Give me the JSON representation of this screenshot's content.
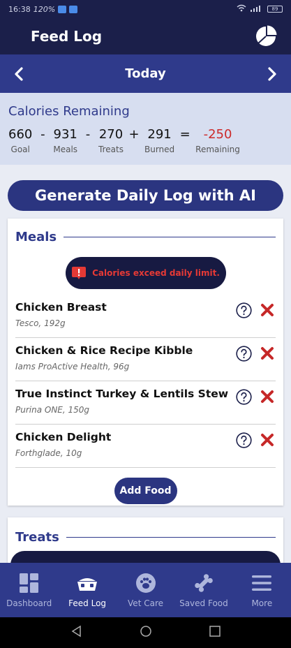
{
  "status_bar": {
    "time": "16:38",
    "speed": "120%",
    "battery": "89"
  },
  "app": {
    "title": "Feed Log"
  },
  "date_bar": {
    "label": "Today",
    "prev_icon": "chevron-left-icon",
    "next_icon": "chevron-right-icon"
  },
  "calories": {
    "title": "Calories Remaining",
    "items": [
      {
        "value": "660",
        "label": "Goal"
      },
      {
        "value": "931",
        "label": "Meals"
      },
      {
        "value": "270",
        "label": "Treats"
      },
      {
        "value": "291",
        "label": "Burned"
      },
      {
        "value": "-250",
        "label": "Remaining"
      }
    ],
    "operators": [
      "-",
      "-",
      "+",
      "="
    ],
    "remaining_color": "#cc2a2a"
  },
  "ai_button": {
    "label": "Generate Daily Log with AI"
  },
  "meals": {
    "title": "Meals",
    "warning": "Calories exceed daily limit.",
    "items": [
      {
        "name": "Chicken Breast",
        "brand": "Tesco,",
        "amount": "192g"
      },
      {
        "name": "Chicken & Rice Recipe Kibble",
        "brand": "Iams ProActive Health,",
        "amount": "96g"
      },
      {
        "name": "True Instinct Turkey & Lentils Stew",
        "brand": "Purina ONE,",
        "amount": "150g"
      },
      {
        "name": "Chicken Delight",
        "brand": "Forthglade,",
        "amount": "10g"
      }
    ],
    "add_label": "Add Food"
  },
  "treats": {
    "title": "Treats"
  },
  "bottom_nav": {
    "items": [
      {
        "label": "Dashboard",
        "icon": "dashboard-icon"
      },
      {
        "label": "Feed Log",
        "icon": "bowl-icon"
      },
      {
        "label": "Vet Care",
        "icon": "paw-icon"
      },
      {
        "label": "Saved Food",
        "icon": "bone-icon"
      },
      {
        "label": "More",
        "icon": "menu-icon"
      }
    ],
    "active": "Feed Log"
  },
  "colors": {
    "header": "#1b1f4a",
    "accent": "#2f3a8b",
    "danger": "#e53935"
  }
}
